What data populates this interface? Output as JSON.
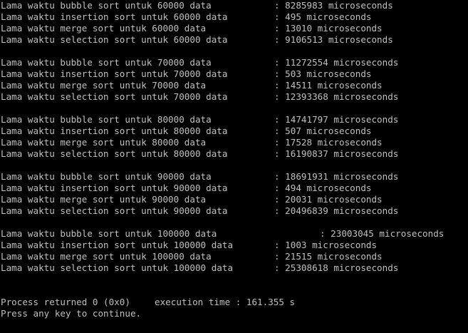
{
  "colors": {
    "background": "#000000",
    "text": "#c0c0c0"
  },
  "results": [
    {
      "label": "Lama waktu bubble sort untuk 60000 data",
      "value": ": 8285983 microseconds"
    },
    {
      "label": "Lama waktu insertion sort untuk 60000 data",
      "value": ": 495 microseconds"
    },
    {
      "label": "Lama waktu merge sort untuk 60000 data",
      "value": ": 13010 microseconds"
    },
    {
      "label": "Lama waktu selection sort untuk 60000 data",
      "value": ": 9106513 microseconds"
    },
    {
      "label": "Lama waktu bubble sort untuk 70000 data",
      "value": ": 11272554 microseconds"
    },
    {
      "label": "Lama waktu insertion sort untuk 70000 data",
      "value": ": 503 microseconds"
    },
    {
      "label": "Lama waktu merge sort untuk 70000 data",
      "value": ": 14511 microseconds"
    },
    {
      "label": "Lama waktu selection sort untuk 70000 data",
      "value": ": 12393368 microseconds"
    },
    {
      "label": "Lama waktu bubble sort untuk 80000 data",
      "value": ": 14741797 microseconds"
    },
    {
      "label": "Lama waktu insertion sort untuk 80000 data",
      "value": ": 507 microseconds"
    },
    {
      "label": "Lama waktu merge sort untuk 80000 data",
      "value": ": 17528 microseconds"
    },
    {
      "label": "Lama waktu selection sort untuk 80000 data",
      "value": ": 16190837 microseconds"
    },
    {
      "label": "Lama waktu bubble sort untuk 90000 data",
      "value": ": 18691931 microseconds"
    },
    {
      "label": "Lama waktu insertion sort untuk 90000 data",
      "value": ": 494 microseconds"
    },
    {
      "label": "Lama waktu merge sort untuk 90000 data",
      "value": ": 20031 microseconds"
    },
    {
      "label": "Lama waktu selection sort untuk 90000 data",
      "value": ": 20496839 microseconds"
    },
    {
      "label": "Lama waktu bubble sort untuk 100000 data",
      "value": ": 23003045 microseconds"
    },
    {
      "label": "Lama waktu insertion sort untuk 100000 data",
      "value": ": 1003 microseconds"
    },
    {
      "label": "Lama waktu merge sort untuk 100000 data",
      "value": ": 21515 microseconds"
    },
    {
      "label": "Lama waktu selection sort untuk 100000 data",
      "value": ": 25308618 microseconds"
    }
  ],
  "footer": {
    "process_returned": "Process returned 0 (0x0)",
    "execution_time": "execution time : 161.355 s",
    "press_key": "Press any key to continue."
  }
}
